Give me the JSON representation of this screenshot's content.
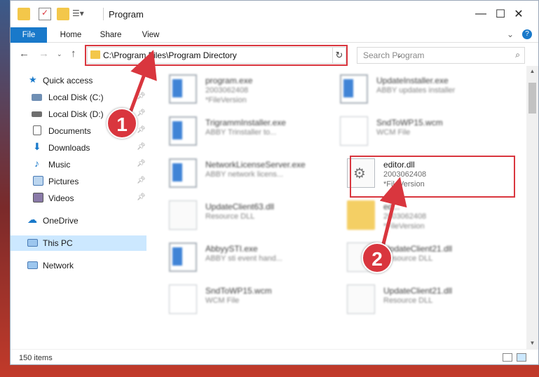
{
  "window": {
    "title": "Program",
    "controls": {
      "minimize": "—",
      "maximize": "☐",
      "close": "✕"
    }
  },
  "ribbon": {
    "tabs": [
      "File",
      "Home",
      "Share",
      "View"
    ],
    "expand_icon": "chevron-down",
    "help_icon": "?"
  },
  "address": {
    "path": "C:\\Program Files\\Program Directory",
    "dropdown": "⌄",
    "refresh": "↻"
  },
  "search": {
    "placeholder": "Search Program",
    "icon": "⌕"
  },
  "sidebar": {
    "quick_access": "Quick access",
    "items": [
      {
        "label": "Local Disk (C:)",
        "icon": "drive-icon",
        "pinned": true
      },
      {
        "label": "Local Disk (D:)",
        "icon": "drive-icon",
        "pinned": true
      },
      {
        "label": "Documents",
        "icon": "documents-icon",
        "pinned": true
      },
      {
        "label": "Downloads",
        "icon": "downloads-icon",
        "pinned": true
      },
      {
        "label": "Music",
        "icon": "music-icon",
        "pinned": true
      },
      {
        "label": "Pictures",
        "icon": "pictures-icon",
        "pinned": true
      },
      {
        "label": "Videos",
        "icon": "videos-icon",
        "pinned": true
      }
    ],
    "onedrive": "OneDrive",
    "this_pc": "This PC",
    "network": "Network"
  },
  "files": [
    {
      "name": "program.exe",
      "sub1": "2003062408",
      "sub2": "*FileVersion",
      "icon": "exe",
      "blurred": true
    },
    {
      "name": "UpdateInstaller.exe",
      "sub1": "ABBY updates installer",
      "sub2": "",
      "icon": "exe",
      "blurred": true
    },
    {
      "name": "TrigrammInstaller.exe",
      "sub1": "ABBY Trinstaller to...",
      "sub2": "",
      "icon": "exe",
      "blurred": true
    },
    {
      "name": "SndToWP15.wcm",
      "sub1": "WCM File",
      "sub2": "",
      "icon": "doc",
      "blurred": true
    },
    {
      "name": "NetworkLicenseServer.exe",
      "sub1": "ABBY network licens...",
      "sub2": "",
      "icon": "exe",
      "blurred": true
    },
    {
      "name": "editor.dll",
      "sub1": "2003062408",
      "sub2": "*FileVersion",
      "icon": "dll",
      "blurred": false
    },
    {
      "name": "UpdateClient63.dll",
      "sub1": "Resource DLL",
      "sub2": "",
      "icon": "dll",
      "blurred": true
    },
    {
      "name": "ed...",
      "sub1": "2003062408",
      "sub2": "*FileVersion",
      "icon": "folder",
      "blurred": true
    },
    {
      "name": "AbbyySTI.exe",
      "sub1": "ABBY sti event hand...",
      "sub2": "",
      "icon": "exe",
      "blurred": true
    },
    {
      "name": "UpdateClient21.dll",
      "sub1": "Resource DLL",
      "sub2": "",
      "icon": "dll",
      "blurred": true
    },
    {
      "name": "SndToWP15.wcm",
      "sub1": "WCM File",
      "sub2": "",
      "icon": "doc",
      "blurred": true
    },
    {
      "name": "UpdateClient21.dll",
      "sub1": "Resource DLL",
      "sub2": "",
      "icon": "dll",
      "blurred": true
    }
  ],
  "annotations": {
    "step1": "1",
    "step2": "2"
  },
  "status": {
    "count": "150 items"
  },
  "colors": {
    "accent": "#1979ca",
    "highlight": "#d9363e",
    "selection": "#cce8ff"
  }
}
